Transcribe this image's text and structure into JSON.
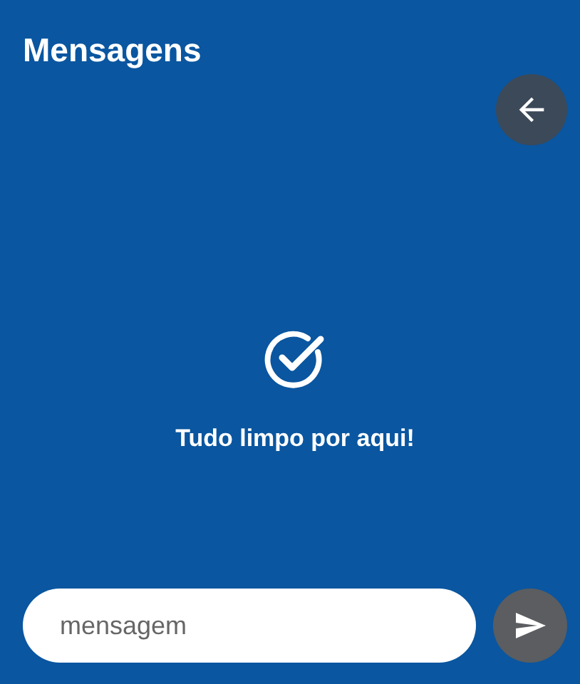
{
  "title": "Mensagens",
  "empty_state": {
    "message": "Tudo limpo por aqui!"
  },
  "composer": {
    "placeholder": "mensagem"
  }
}
